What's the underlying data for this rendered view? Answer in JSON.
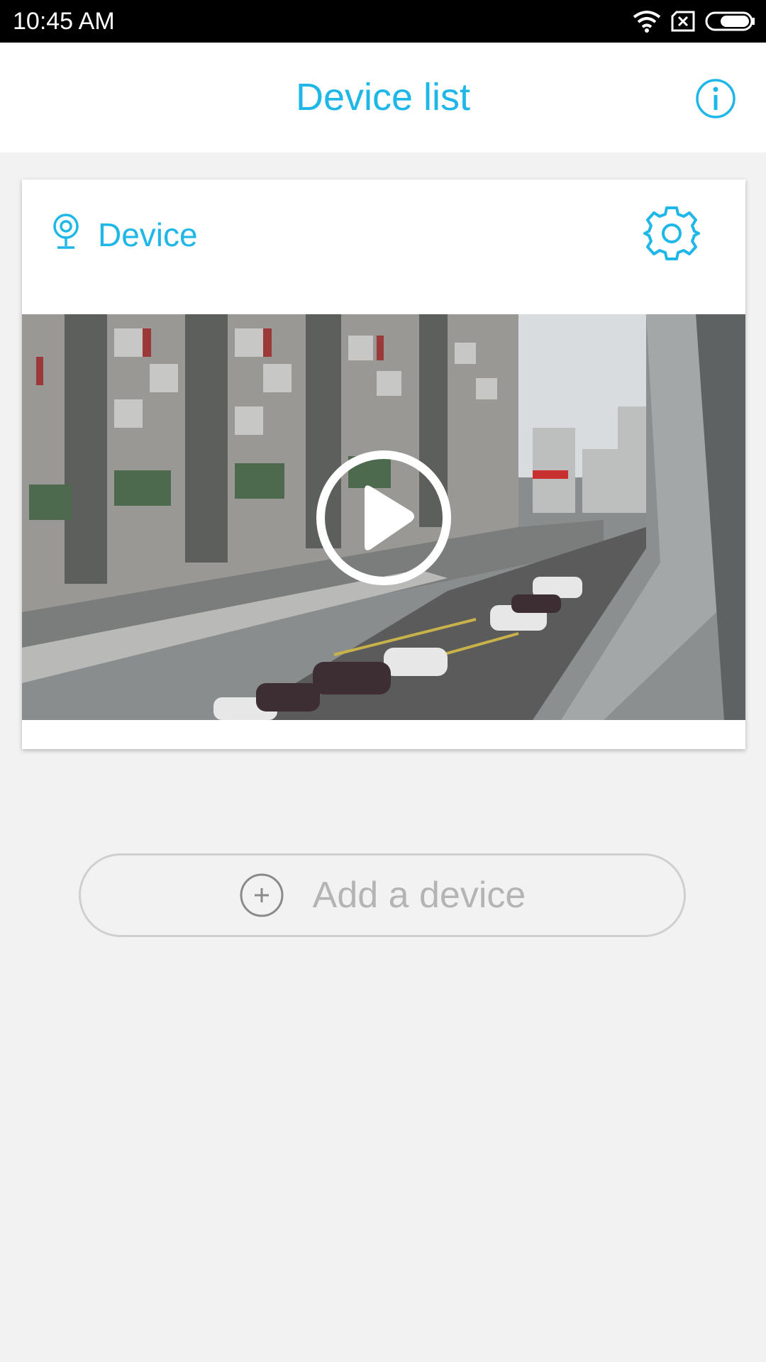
{
  "status_bar": {
    "time": "10:45 AM",
    "icons": [
      "wifi-icon",
      "no-sim-icon",
      "battery-icon"
    ]
  },
  "header": {
    "title": "Device list",
    "info_icon": "info-icon"
  },
  "device_card": {
    "name": "Device",
    "camera_icon": "camera-pin-icon",
    "settings_icon": "gear-icon",
    "preview_icon": "play-icon"
  },
  "add_device": {
    "label": "Add a device",
    "icon": "plus-circle-icon"
  },
  "colors": {
    "accent": "#1fb7e8",
    "background": "#f2f2f2",
    "muted_text": "#b4b4b4"
  }
}
